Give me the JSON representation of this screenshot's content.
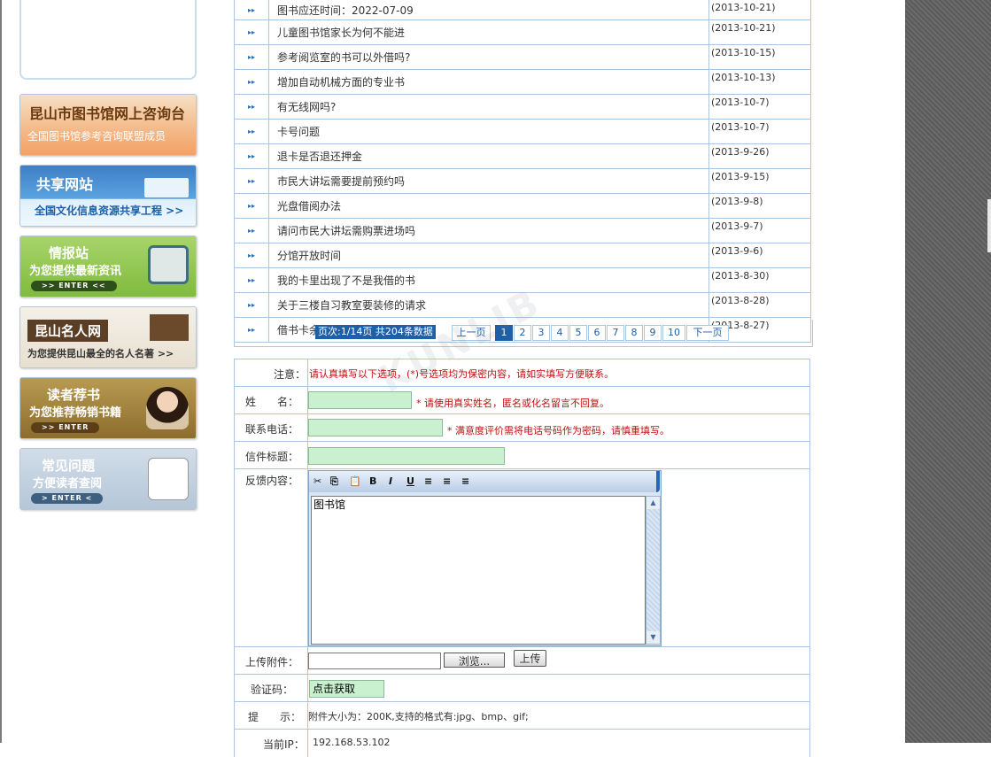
{
  "sidebar": {
    "banners": [
      {
        "title": "昆山市图书馆网上咨询台",
        "subtitle": "全国图书馆参考咨询联盟成员"
      },
      {
        "title": "共享网站",
        "subtitle": "全国文化信息资源共享工程 >>"
      },
      {
        "title": "情报站",
        "subtitle": "为您提供最新资讯",
        "enter": ">> ENTER <<"
      },
      {
        "title": "昆山名人网",
        "subtitle": "为您提供昆山最全的名人名著 >>"
      },
      {
        "title": "读者荐书",
        "subtitle": "为您推荐畅销书籍",
        "enter": ">> ENTER"
      },
      {
        "title": "常见问题",
        "subtitle": "方便读者查阅",
        "enter": "> ENTER <"
      }
    ]
  },
  "questions": [
    {
      "title": "图书应还时间：2022-07-09",
      "date": "(2013-10-21)"
    },
    {
      "title": "儿童图书馆家长为何不能进",
      "date": "(2013-10-21)"
    },
    {
      "title": "参考阅览室的书可以外借吗?",
      "date": "(2013-10-15)"
    },
    {
      "title": "增加自动机械方面的专业书",
      "date": "(2013-10-13)"
    },
    {
      "title": "有无线网吗?",
      "date": "(2013-10-7)"
    },
    {
      "title": "卡号问题",
      "date": "(2013-10-7)"
    },
    {
      "title": "退卡是否退还押金",
      "date": "(2013-9-26)"
    },
    {
      "title": "市民大讲坛需要提前预约吗",
      "date": "(2013-9-15)"
    },
    {
      "title": "光盘借阅办法",
      "date": "(2013-9-8)"
    },
    {
      "title": "请问市民大讲坛需购票进场吗",
      "date": "(2013-9-7)"
    },
    {
      "title": "分馆开放时间",
      "date": "(2013-9-6)"
    },
    {
      "title": "我的卡里出现了不是我借的书",
      "date": "(2013-8-30)"
    },
    {
      "title": "关于三楼自习教室要装修的请求",
      "date": "(2013-8-28)"
    },
    {
      "title": "借书卡余额网上能查询吗？",
      "date": "(2013-8-27)"
    }
  ],
  "pager": {
    "info": "页次:1/14页 共204条数据",
    "prev": "上一页",
    "next": "下一页",
    "pages": [
      "1",
      "2",
      "3",
      "4",
      "5",
      "6",
      "7",
      "8",
      "9",
      "10"
    ],
    "current": "1"
  },
  "form": {
    "notice_label": "注意：",
    "notice_text": "请认真填写以下选项，(*)号选项均为保密内容，请如实填写方便联系。",
    "name_label": "姓　　名：",
    "name_hint": "* 请使用真实姓名，匿名或化名留言不回复。",
    "phone_label": "联系电话：",
    "phone_hint": "* 满意度评价需将电话号码作为密码，请慎重填写。",
    "subject_label": "信件标题：",
    "content_label": "反馈内容：",
    "content_value": "图书馆",
    "attach_label": "上传附件：",
    "browse_label": "浏览...",
    "upload_label": "上传",
    "captcha_label": "验证码：",
    "captcha_text": "点击获取",
    "tip_label": "提　　示：",
    "tip_text": "附件大小为：200K,支持的格式有:jpg、bmp、gif;",
    "ip_label": "当前IP：",
    "ip_value": "192.168.53.102"
  },
  "editor_tools": [
    "cut-icon",
    "copy-icon",
    "paste-icon",
    "bold-icon",
    "italic-icon",
    "underline-icon",
    "align-left-icon",
    "align-center-icon",
    "align-right-icon"
  ]
}
